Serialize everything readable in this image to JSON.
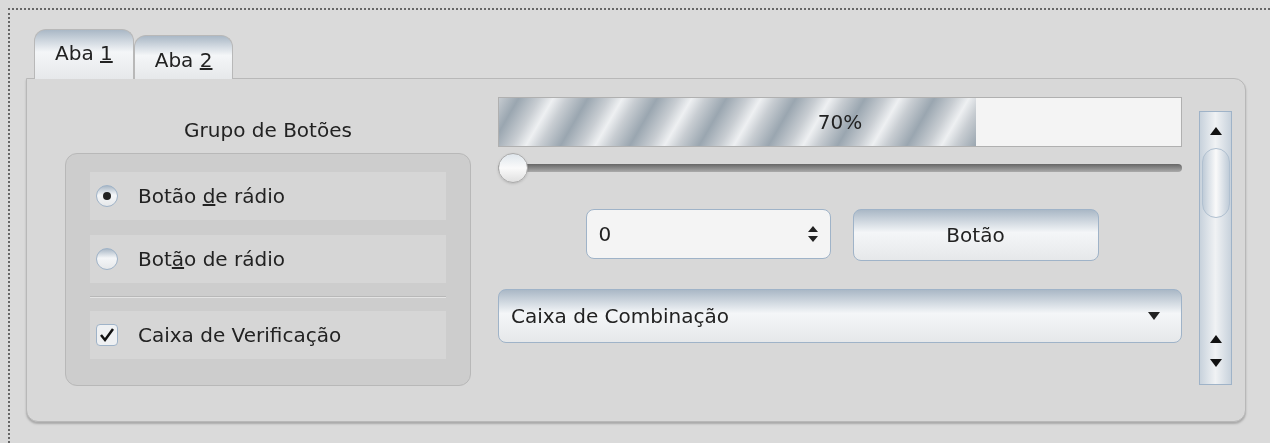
{
  "tabs": [
    {
      "label": [
        {
          "text": "Aba ",
          "underlined": false
        },
        {
          "text": "1",
          "underlined": true
        }
      ],
      "selected": true
    },
    {
      "label": [
        {
          "text": "Aba ",
          "underlined": false
        },
        {
          "text": "2",
          "underlined": true
        }
      ],
      "selected": false
    }
  ],
  "button_group": {
    "title": "Grupo de Botões",
    "items": [
      {
        "kind": "radio",
        "label": [
          {
            "text": "Botão ",
            "underlined": false
          },
          {
            "text": "d",
            "underlined": true
          },
          {
            "text": "e rádio",
            "underlined": false
          }
        ],
        "checked": true
      },
      {
        "kind": "radio",
        "label": [
          {
            "text": "Bot",
            "underlined": false
          },
          {
            "text": "ã",
            "underlined": true
          },
          {
            "text": "o de rádio",
            "underlined": false
          }
        ],
        "checked": false
      },
      {
        "kind": "separator"
      },
      {
        "kind": "checkbox",
        "label": [
          {
            "text": "Caixa de Verificação",
            "underlined": false
          }
        ],
        "checked": true
      }
    ]
  },
  "progress": {
    "level": 0.7,
    "reading": "70%"
  },
  "slider": {
    "level": 0
  },
  "spinbox": {
    "value": "0"
  },
  "button": {
    "label": "Botão"
  },
  "combobox": {
    "value": "Caixa de Combinação"
  }
}
